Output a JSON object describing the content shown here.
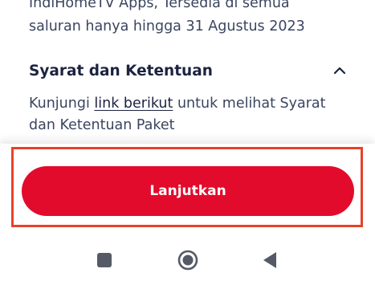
{
  "promo": {
    "line1": "IndiHomeTV Apps, Tersedia di semua",
    "line2": "saluran hanya hingga 31 Agustus 2023"
  },
  "terms": {
    "title": "Syarat dan Ketentuan",
    "toggle_icon": "chevron-up-icon",
    "body_prefix": "Kunjungi ",
    "link_label": "link berikut",
    "body_suffix": " untuk melihat Syarat",
    "body_line2": "dan Ketentuan Paket"
  },
  "action": {
    "continue_label": "Lanjutkan"
  },
  "navbar": {
    "recent_icon": "square-recents-icon",
    "home_icon": "circle-home-icon",
    "back_icon": "triangle-back-icon"
  },
  "colors": {
    "primary": "#e30b2c",
    "highlight": "#e8412a",
    "text_dark": "#1c2340",
    "text_body": "#3a4560"
  }
}
